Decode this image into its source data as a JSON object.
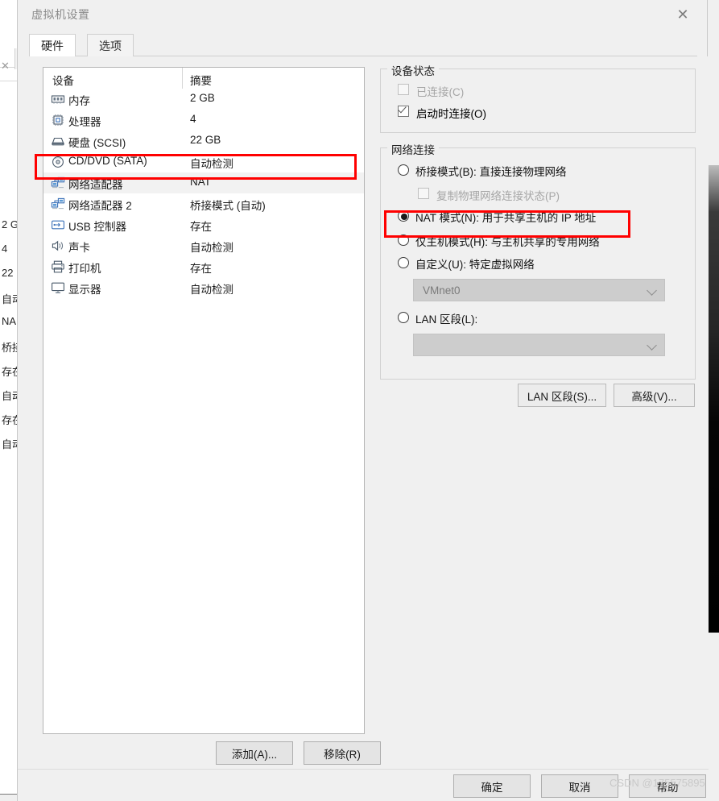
{
  "background": {
    "summary_values": [
      "2 G",
      "4",
      "22",
      "自动",
      "NA",
      "桥接",
      "存在",
      "自动",
      "存在",
      "自动"
    ],
    "close_tab_icon": "close-icon"
  },
  "dialog": {
    "title": "虚拟机设置",
    "close_label": "✕",
    "tabs": [
      {
        "label": "硬件",
        "active": true
      },
      {
        "label": "选项",
        "active": false
      }
    ]
  },
  "device_list": {
    "headers": {
      "device": "设备",
      "summary": "摘要"
    },
    "rows": [
      {
        "name": "内存",
        "value": "2 GB",
        "icon": "memory-icon",
        "selected": false
      },
      {
        "name": "处理器",
        "value": "4",
        "icon": "cpu-icon",
        "selected": false
      },
      {
        "name": "硬盘 (SCSI)",
        "value": "22 GB",
        "icon": "harddisk-icon",
        "selected": false
      },
      {
        "name": "CD/DVD (SATA)",
        "value": "自动检测",
        "icon": "cddvd-icon",
        "selected": false
      },
      {
        "name": "网络适配器",
        "value": "NAT",
        "icon": "network-icon",
        "selected": true
      },
      {
        "name": "网络适配器 2",
        "value": "桥接模式 (自动)",
        "icon": "network-icon",
        "selected": false
      },
      {
        "name": "USB 控制器",
        "value": "存在",
        "icon": "usb-icon",
        "selected": false
      },
      {
        "name": "声卡",
        "value": "自动检测",
        "icon": "sound-icon",
        "selected": false
      },
      {
        "name": "打印机",
        "value": "存在",
        "icon": "printer-icon",
        "selected": false
      },
      {
        "name": "显示器",
        "value": "自动检测",
        "icon": "display-icon",
        "selected": false
      }
    ],
    "buttons": {
      "add": "添加(A)...",
      "remove": "移除(R)"
    }
  },
  "device_status": {
    "legend": "设备状态",
    "connected": {
      "label": "已连接(C)",
      "checked": false,
      "disabled": true
    },
    "connect_at_power_on": {
      "label": "启动时连接(O)",
      "checked": true,
      "disabled": false
    }
  },
  "network_connection": {
    "legend": "网络连接",
    "options": [
      {
        "label": "桥接模式(B): 直接连接物理网络",
        "selected": false
      },
      {
        "label": "NAT 模式(N): 用于共享主机的 IP 地址",
        "selected": true
      },
      {
        "label": "仅主机模式(H): 与主机共享的专用网络",
        "selected": false
      },
      {
        "label": "自定义(U): 特定虚拟网络",
        "selected": false
      },
      {
        "label": "LAN 区段(L):",
        "selected": false
      }
    ],
    "replicate_state": {
      "label": "复制物理网络连接状态(P)",
      "checked": false,
      "disabled": true
    },
    "custom_network_value": "VMnet0",
    "lan_segment_value": "",
    "buttons": {
      "lan_segments": "LAN 区段(S)...",
      "advanced": "高级(V)..."
    }
  },
  "footer": {
    "ok": "确定",
    "cancel": "取消",
    "help": "帮助"
  },
  "watermark": "CSDN @175575895",
  "colors": {
    "highlight": "#ff0000",
    "dialog_bg": "#f0f0f0",
    "selection": "#f2f2f2"
  }
}
